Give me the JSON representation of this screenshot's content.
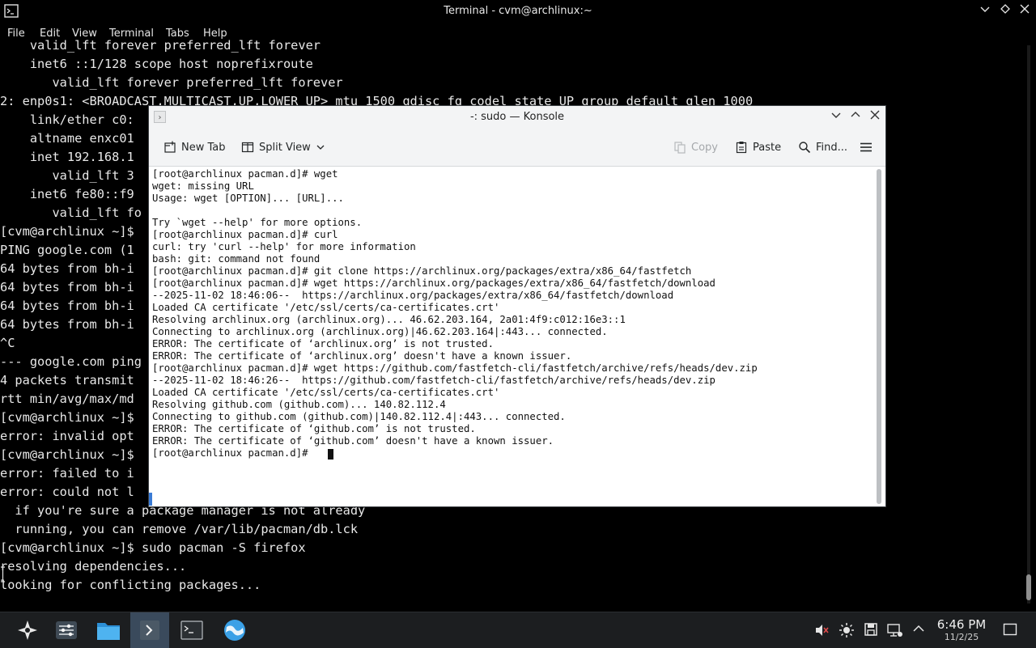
{
  "background_terminal": {
    "title": "Terminal - cvm@archlinux:~",
    "menu": [
      "File",
      "Edit",
      "View",
      "Terminal",
      "Tabs",
      "Help"
    ],
    "lines": [
      "    valid_lft forever preferred_lft forever",
      "    inet6 ::1/128 scope host noprefixroute",
      "       valid_lft forever preferred_lft forever",
      "2: enp0s1: <BROADCAST,MULTICAST,UP,LOWER_UP> mtu 1500 qdisc fq_codel state UP group default qlen 1000",
      "    link/ether c0:",
      "    altname enxc01",
      "    inet 192.168.1",
      "       valid_lft 3",
      "    inet6 fe80::f9",
      "       valid_lft fo",
      "[cvm@archlinux ~]$",
      "PING google.com (1",
      "64 bytes from bh-i",
      "64 bytes from bh-i",
      "64 bytes from bh-i",
      "64 bytes from bh-i",
      "^C",
      "--- google.com ping",
      "4 packets transmit",
      "rtt min/avg/max/md",
      "[cvm@archlinux ~]$",
      "error: invalid opt",
      "[cvm@archlinux ~]$",
      "error: failed to i",
      "error: could not l",
      "  if you're sure a package manager is not already",
      "  running, you can remove /var/lib/pacman/db.lck",
      "[cvm@archlinux ~]$ sudo pacman -S firefox",
      "resolving dependencies...",
      "looking for conflicting packages..."
    ]
  },
  "konsole": {
    "title": "-: sudo — Konsole",
    "toolbar": {
      "new_tab": "New Tab",
      "split_view": "Split View",
      "copy": "Copy",
      "paste": "Paste",
      "find": "Find..."
    },
    "lines": [
      "[root@archlinux pacman.d]# wget",
      "wget: missing URL",
      "Usage: wget [OPTION]... [URL]...",
      "",
      "Try `wget --help' for more options.",
      "[root@archlinux pacman.d]# curl",
      "curl: try 'curl --help' for more information",
      "bash: git: command not found",
      "[root@archlinux pacman.d]# git clone https://archlinux.org/packages/extra/x86_64/fastfetch",
      "[root@archlinux pacman.d]# wget https://archlinux.org/packages/extra/x86_64/fastfetch/download",
      "--2025-11-02 18:46:06--  https://archlinux.org/packages/extra/x86_64/fastfetch/download",
      "Loaded CA certificate '/etc/ssl/certs/ca-certificates.crt'",
      "Resolving archlinux.org (archlinux.org)... 46.62.203.164, 2a01:4f9:c012:16e3::1",
      "Connecting to archlinux.org (archlinux.org)|46.62.203.164|:443... connected.",
      "ERROR: The certificate of ‘archlinux.org’ is not trusted.",
      "ERROR: The certificate of ‘archlinux.org’ doesn't have a known issuer.",
      "[root@archlinux pacman.d]# wget https://github.com/fastfetch-cli/fastfetch/archive/refs/heads/dev.zip",
      "--2025-11-02 18:46:26--  https://github.com/fastfetch-cli/fastfetch/archive/refs/heads/dev.zip",
      "Loaded CA certificate '/etc/ssl/certs/ca-certificates.crt'",
      "Resolving github.com (github.com)... 140.82.112.4",
      "Connecting to github.com (github.com)|140.82.112.4|:443... connected.",
      "ERROR: The certificate of ‘github.com’ is not trusted.",
      "ERROR: The certificate of ‘github.com’ doesn't have a known issuer.",
      "[root@archlinux pacman.d]# "
    ]
  },
  "taskbar": {
    "apps": [
      "app-launcher-icon",
      "system-settings-icon",
      "file-manager-icon",
      "konsole-icon",
      "terminal-icon",
      "browser-icon"
    ],
    "time": "6:46 PM",
    "date": "11/2/25"
  }
}
